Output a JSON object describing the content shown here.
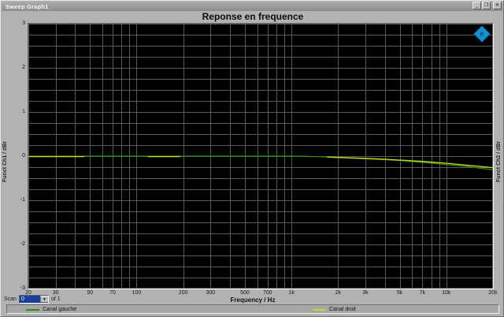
{
  "window": {
    "title": "Sweep Graph1",
    "buttons": {
      "minimize": "_",
      "restore": "❐",
      "close": "✕"
    }
  },
  "scan": {
    "label": "Scan",
    "value": "0",
    "suffix": "of 1"
  },
  "logo": {
    "name": "Rohde & Schwarz",
    "color": "#1592cf",
    "text": "R&S"
  },
  "chart_data": {
    "type": "line",
    "title": "Reponse en frequence",
    "xlabel": "Frequency / Hz",
    "ylabel_left": "Funct Ch1 / dBr",
    "ylabel_right": "Funct Ch2 / dBr",
    "x_scale": "log",
    "xlim": [
      20,
      20000
    ],
    "ylim": [
      -3,
      3
    ],
    "y_minor_step": 0.25,
    "grid": true,
    "grid_color": "#5a5a5a",
    "plot_bg": "#000000",
    "legend_position": "bottom",
    "x_ticks": [
      {
        "f": 20,
        "label": "20"
      },
      {
        "f": 30,
        "label": "30"
      },
      {
        "f": 50,
        "label": "50"
      },
      {
        "f": 70,
        "label": "70"
      },
      {
        "f": 100,
        "label": "100"
      },
      {
        "f": 200,
        "label": "200"
      },
      {
        "f": 300,
        "label": "300"
      },
      {
        "f": 500,
        "label": "500"
      },
      {
        "f": 700,
        "label": "700"
      },
      {
        "f": 1000,
        "label": "1k"
      },
      {
        "f": 2000,
        "label": "2k"
      },
      {
        "f": 3000,
        "label": "3k"
      },
      {
        "f": 5000,
        "label": "5k"
      },
      {
        "f": 7000,
        "label": "7k"
      },
      {
        "f": 10000,
        "label": "10k"
      },
      {
        "f": 20000,
        "label": "20k"
      }
    ],
    "y_ticks": [
      {
        "v": 3,
        "label": "3"
      },
      {
        "v": 2,
        "label": "2"
      },
      {
        "v": 1,
        "label": "1"
      },
      {
        "v": 0,
        "label": "0"
      },
      {
        "v": -1,
        "label": "-1"
      },
      {
        "v": -2,
        "label": "-2"
      },
      {
        "v": -3,
        "label": "-3"
      }
    ],
    "series": [
      {
        "name": "Canal gauche",
        "color": "#2f8c0c",
        "segments": [
          [
            [
              20,
              0
            ],
            [
              100,
              0
            ],
            [
              500,
              0
            ],
            [
              1000,
              0
            ],
            [
              1500,
              -0.01
            ],
            [
              2000,
              -0.03
            ],
            [
              3000,
              -0.06
            ],
            [
              4000,
              -0.08
            ],
            [
              5000,
              -0.1
            ],
            [
              7000,
              -0.14
            ],
            [
              10000,
              -0.19
            ],
            [
              14000,
              -0.24
            ],
            [
              20000,
              -0.31
            ]
          ]
        ]
      },
      {
        "name": "Canal droit",
        "color": "#c2da28",
        "segments": [
          [
            [
              20,
              -0.01
            ],
            [
              46,
              -0.01
            ]
          ],
          [
            [
              118,
              -0.01
            ],
            [
              192,
              -0.01
            ]
          ],
          [
            [
              1700,
              -0.02
            ],
            [
              2000,
              -0.03
            ],
            [
              3000,
              -0.05
            ],
            [
              4000,
              -0.07
            ],
            [
              5000,
              -0.09
            ],
            [
              7000,
              -0.12
            ],
            [
              10000,
              -0.16
            ],
            [
              14000,
              -0.21
            ],
            [
              20000,
              -0.26
            ]
          ]
        ]
      }
    ]
  }
}
